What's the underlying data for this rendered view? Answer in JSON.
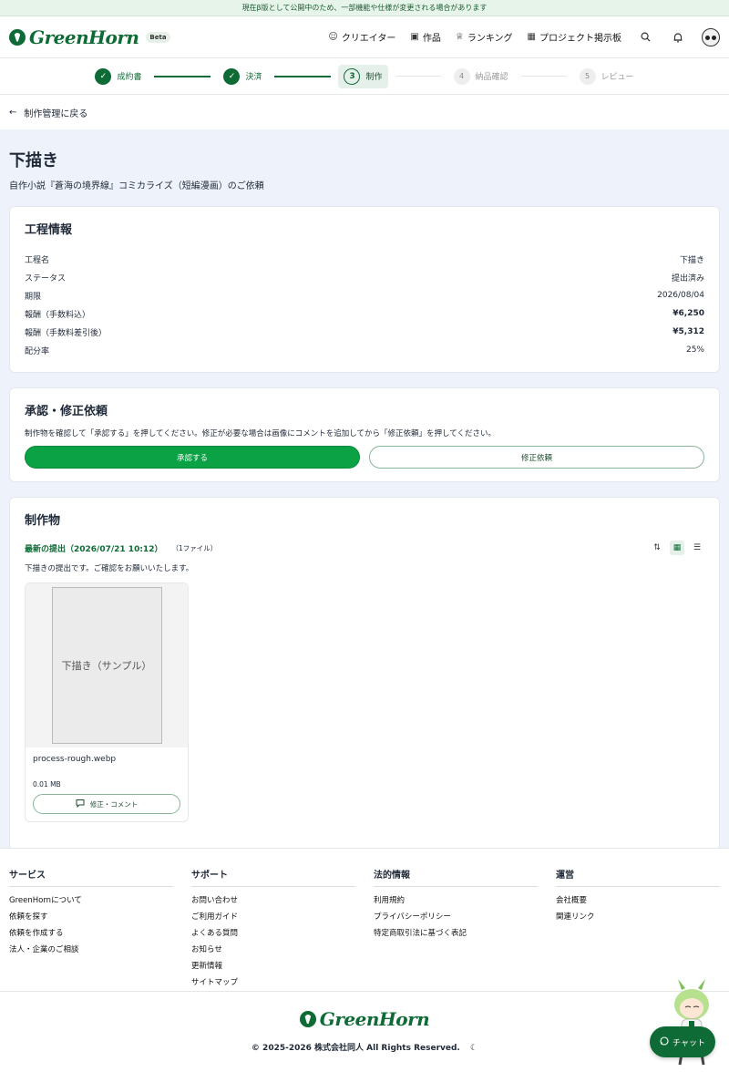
{
  "banner": "現在β版として公開中のため、一部機能や仕様が変更される場合があります",
  "brand": {
    "name": "GreenHorn",
    "beta": "Beta"
  },
  "nav": {
    "creators": "クリエイター",
    "works": "作品",
    "ranking": "ランキング",
    "board": "プロジェクト掲示板"
  },
  "steps": [
    {
      "num": "1",
      "label": "成約書",
      "state": "done"
    },
    {
      "num": "2",
      "label": "決済",
      "state": "done"
    },
    {
      "num": "3",
      "label": "制作",
      "state": "current"
    },
    {
      "num": "4",
      "label": "納品確認",
      "state": "todo"
    },
    {
      "num": "5",
      "label": "レビュー",
      "state": "todo"
    }
  ],
  "back": "制作管理に戻る",
  "page": {
    "title": "下描き",
    "subtitle": "自作小説『蒼海の境界線』コミカライズ（短編漫画）のご依頼"
  },
  "process": {
    "heading": "工程情報",
    "rows": [
      {
        "k": "工程名",
        "v": "下描き"
      },
      {
        "k": "ステータス",
        "v": "提出済み"
      },
      {
        "k": "期限",
        "v": "2026/08/04"
      },
      {
        "k": "報酬（手数料込）",
        "v": "¥6,250"
      },
      {
        "k": "報酬（手数料差引後）",
        "v": "¥5,312"
      },
      {
        "k": "配分率",
        "v": "25%"
      }
    ]
  },
  "approval": {
    "heading": "承認・修正依頼",
    "message": "制作物を確認して「承認する」を押してください。修正が必要な場合は画像にコメントを追加してから「修正依頼」を押してください。",
    "approve": "承認する",
    "revise": "修正依頼"
  },
  "deliverables": {
    "heading": "制作物",
    "latest": "最新の提出（2026/07/21 10:12）",
    "count": "（1ファイル）",
    "comment": "下描きの提出です。ご確認をお願いいたします。",
    "file": {
      "thumb": "下描き（サンプル）",
      "name": "process-rough.webp",
      "size": "0.01 MB",
      "action": "修正・コメント"
    }
  },
  "footer": {
    "cols": [
      {
        "title": "サービス",
        "links": [
          "GreenHornについて",
          "依頼を探す",
          "依頼を作成する",
          "法人・企業のご相談"
        ]
      },
      {
        "title": "サポート",
        "links": [
          "お問い合わせ",
          "ご利用ガイド",
          "よくある質問",
          "お知らせ",
          "更新情報",
          "サイトマップ"
        ]
      },
      {
        "title": "法的情報",
        "links": [
          "利用規約",
          "プライバシーポリシー",
          "特定商取引法に基づく表記"
        ]
      },
      {
        "title": "運営",
        "links": [
          "会社概要",
          "関連リンク"
        ]
      }
    ],
    "copyright": "© 2025-2026 株式会社同人 All Rights Reserved."
  },
  "chat": "チャット"
}
